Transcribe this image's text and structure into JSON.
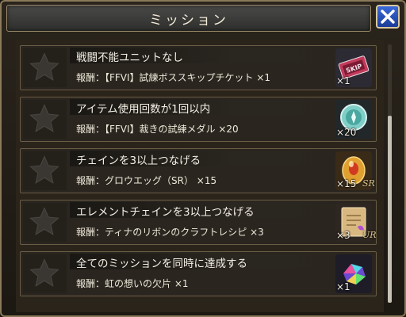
{
  "header": {
    "title": "ミッション"
  },
  "missions": [
    {
      "title": "戦闘不能ユニットなし",
      "reward": "報酬：【FFVI】試練ボススキップチケット ×1",
      "qty": "×1",
      "icon": "skip-ticket-icon",
      "rank": ""
    },
    {
      "title": "アイテム使用回数が1回以内",
      "reward": "報酬：【FFVI】裁きの試練メダル ×20",
      "qty": "×20",
      "icon": "medal-icon",
      "rank": ""
    },
    {
      "title": "チェインを3以上つなげる",
      "reward": "報酬：グロウエッグ（SR） ×15",
      "qty": "×15",
      "icon": "grow-egg-icon",
      "rank": "SR"
    },
    {
      "title": "エレメントチェインを3以上つなげる",
      "reward": "報酬：ティナのリボンのクラフトレシピ ×3",
      "qty": "×3",
      "icon": "recipe-icon",
      "rank": "UR"
    },
    {
      "title": "全てのミッションを同時に達成する",
      "reward": "報酬：虹の想いの欠片 ×1",
      "qty": "×1",
      "icon": "rainbow-crystal-icon",
      "rank": ""
    }
  ],
  "colors": {
    "close_button": "#2a52c0",
    "star": "#3a3632",
    "frame": "#8a7a5a"
  }
}
